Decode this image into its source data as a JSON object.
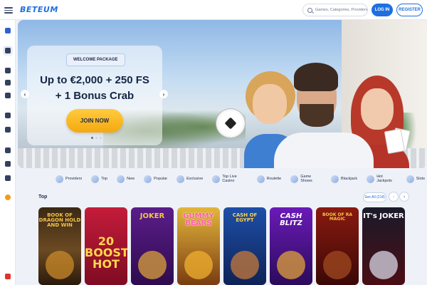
{
  "header": {
    "logo": "BETEUM",
    "search_placeholder": "Games, Categories, Providers",
    "login_label": "LOG IN",
    "register_label": "REGISTER"
  },
  "hero": {
    "tag": "WELCOME PACKAGE",
    "headline_line1": "Up to €2,000 + 250 FS",
    "headline_line2": "+ 1 Bonus Crab",
    "cta_label": "JOIN NOW",
    "arrow_prev": "‹",
    "arrow_next": "›",
    "slides": 3,
    "active_slide": 1
  },
  "categories": [
    {
      "label": "Providers",
      "icon": "providers-icon"
    },
    {
      "label": "Top",
      "icon": "star-icon"
    },
    {
      "label": "New",
      "icon": "new-icon"
    },
    {
      "label": "Popular",
      "icon": "popular-icon"
    },
    {
      "label": "Exclusive",
      "icon": "exclusive-icon"
    },
    {
      "label": "Top Live Casino",
      "icon": "live-casino-icon"
    },
    {
      "label": "Roulette",
      "icon": "roulette-icon"
    },
    {
      "label": "Game Shows",
      "icon": "game-shows-icon"
    },
    {
      "label": "Blackjack",
      "icon": "blackjack-icon"
    },
    {
      "label": "Hot Jackpots",
      "icon": "jackpot-icon"
    },
    {
      "label": "Slots",
      "icon": "slots-icon"
    }
  ],
  "top_section": {
    "title": "Top",
    "see_all": "See All (218)",
    "prev": "‹",
    "next": "›"
  },
  "games": [
    {
      "title": "BOOK OF DRAGON HOLD AND WIN"
    },
    {
      "title": "20 BOOST HOT"
    },
    {
      "title": "JOKER"
    },
    {
      "title": "GUMMY BEARS"
    },
    {
      "title": "CASH OF EGYPT"
    },
    {
      "title": "CASH BLITZ"
    },
    {
      "title": "BOOK OF RA MAGIC"
    },
    {
      "title": "IT's JOKER"
    }
  ],
  "colors": {
    "accent": "#1f6fe0",
    "cta": "#f5a80f"
  }
}
